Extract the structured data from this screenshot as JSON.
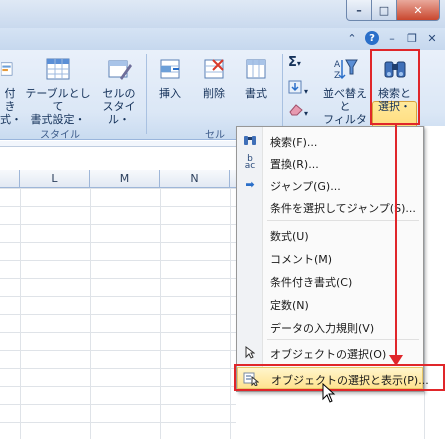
{
  "window": {
    "minimize": "–",
    "maximize": "□",
    "close": "✕"
  },
  "ribbon_icons": [
    "chevron-up-icon",
    "help-icon",
    "minimize-ribbon-icon",
    "restore-icon",
    "close-icon"
  ],
  "ribbon": {
    "btn_conditional_1": "付き",
    "btn_conditional_2": "式・",
    "btn_table_1": "テーブルとして",
    "btn_table_2": "書式設定・",
    "btn_cellstyle_1": "セルの",
    "btn_cellstyle_2": "スタイル・",
    "group_style": "スタイル",
    "btn_insert": "挿入",
    "btn_delete": "削除",
    "btn_format": "書式",
    "group_cell": "セル",
    "btn_sort_1": "並べ替えと",
    "btn_sort_2": "フィルター・",
    "btn_find_1": "検索と",
    "btn_find_2": "選択・",
    "sigma": "Σ"
  },
  "columns": [
    "L",
    "M",
    "N"
  ],
  "menu": {
    "items": [
      {
        "label": "検索(F)...",
        "icon": "binoculars-icon"
      },
      {
        "label": "置換(R)...",
        "icon": "replace-icon"
      },
      {
        "label": "ジャンプ(G)...",
        "icon": "arrow-right-icon"
      },
      {
        "label": "条件を選択してジャンプ(S)...",
        "icon": ""
      },
      {
        "label": "数式(U)",
        "icon": ""
      },
      {
        "label": "コメント(M)",
        "icon": ""
      },
      {
        "label": "条件付き書式(C)",
        "icon": ""
      },
      {
        "label": "定数(N)",
        "icon": ""
      },
      {
        "label": "データの入力規則(V)",
        "icon": ""
      },
      {
        "label": "オブジェクトの選択(O)",
        "icon": "pointer-icon"
      },
      {
        "label": "オブジェクトの選択と表示(P)...",
        "icon": "selection-pane-icon"
      }
    ]
  },
  "colors": {
    "highlight_border": "#e0262a",
    "active_button": "#ffc64c"
  }
}
